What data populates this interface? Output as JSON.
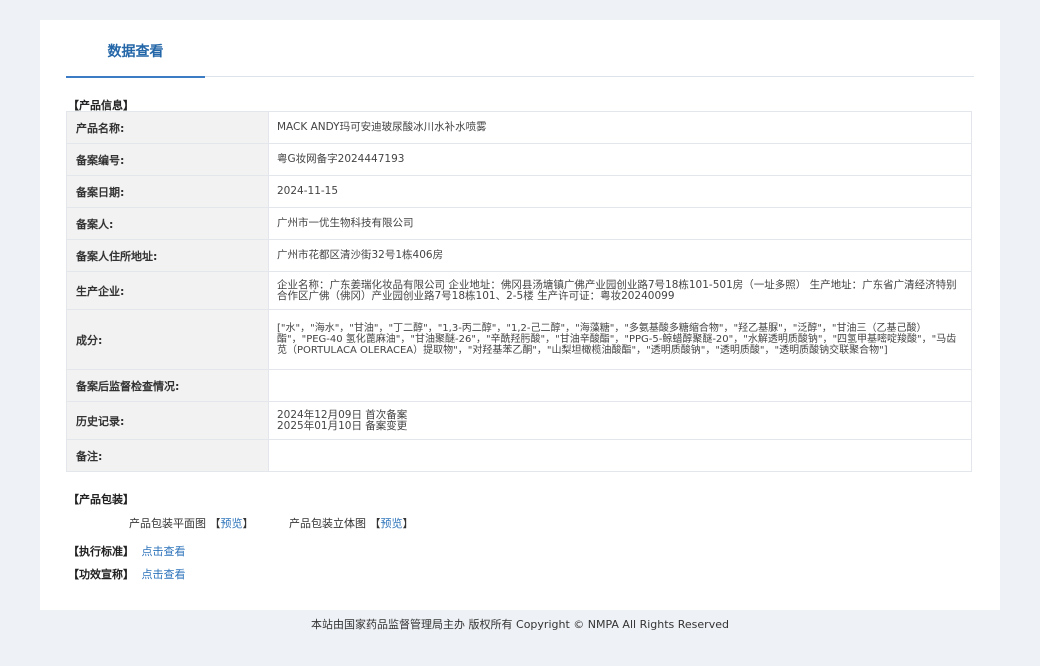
{
  "tab": {
    "label": "数据查看"
  },
  "sections": {
    "product_info": "【产品信息】",
    "packaging": "【产品包装】",
    "standard": "【执行标准】",
    "claims": "【功效宣称】"
  },
  "info_rows": [
    {
      "label": "产品名称:",
      "value": "MACK ANDY玛可安迪玻尿酸冰川水补水喷雾"
    },
    {
      "label": "备案编号:",
      "value": "粤G妆网备字2024447193"
    },
    {
      "label": "备案日期:",
      "value": "2024-11-15"
    },
    {
      "label": "备案人:",
      "value": "广州市一优生物科技有限公司"
    },
    {
      "label": "备案人住所地址:",
      "value": "广州市花都区清沙街32号1栋406房"
    },
    {
      "label": "生产企业:",
      "value": "企业名称：广东姜瑞化妆品有限公司 企业地址：佛冈县汤塘镇广佛产业园创业路7号18栋101-501房（一址多照） 生产地址：广东省广清经济特别合作区广佛（佛冈）产业园创业路7号18栋101、2-5楼 生产许可证：粤妆20240099"
    },
    {
      "label": "成分:",
      "value": "[\"水\"，\"海水\"，\"甘油\"，\"丁二醇\"，\"1,3-丙二醇\"，\"1,2-己二醇\"，\"海藻糖\"，\"多氨基酸多糖缩合物\"，\"羟乙基脲\"，\"泛醇\"，\"甘油三（乙基己酸）酯\"，\"PEG-40 氢化蓖麻油\"，\"甘油聚醚-26\"，\"辛酰羟肟酸\"，\"甘油辛酸酯\"，\"PPG-5-鲸蜡醇聚醚-20\"，\"水解透明质酸钠\"，\"四氢甲基嘧啶羧酸\"，\"马齿苋（PORTULACA OLERACEA）提取物\"，\"对羟基苯乙酮\"，\"山梨坦橄榄油酸酯\"，\"透明质酸钠\"，\"透明质酸\"，\"透明质酸钠交联聚合物\"]"
    },
    {
      "label": "备案后监督检查情况:",
      "value": ""
    },
    {
      "label": "历史记录:",
      "value": "2024年12月09日 首次备案\n2025年01月10日 备案变更"
    },
    {
      "label": "备注:",
      "value": ""
    }
  ],
  "packaging": {
    "flat_label": "产品包装平面图",
    "solid_label": "产品包装立体图",
    "preview": "预览",
    "bracket_open": "【",
    "bracket_close": "】"
  },
  "links": {
    "view": "点击查看"
  },
  "footer": "本站由国家药品监督管理局主办 版权所有 Copyright © NMPA All Rights Reserved"
}
